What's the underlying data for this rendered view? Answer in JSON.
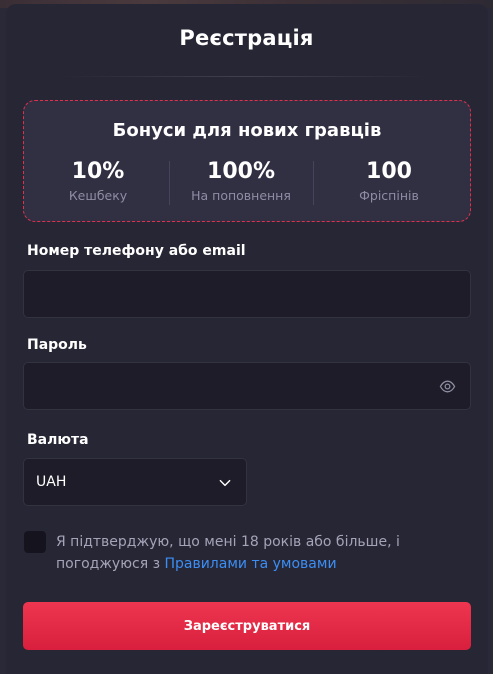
{
  "title": "Реєстрація",
  "bonuses": {
    "title": "Бонуси для нових гравців",
    "items": [
      {
        "value": "10%",
        "label": "Кешбеку"
      },
      {
        "value": "100%",
        "label": "На поповнення"
      },
      {
        "value": "100",
        "label": "Фріспінів"
      }
    ]
  },
  "form": {
    "login_label": "Номер телефону або email",
    "login_value": "",
    "password_label": "Пароль",
    "password_value": "",
    "currency_label": "Валюта",
    "currency_value": "UAH",
    "consent_text": "Я підтверджую, що мені 18 років або більше, і погоджуюся з ",
    "consent_link": "Правилами та умовами",
    "submit_label": "Зареєструватися"
  },
  "colors": {
    "accent": "#e0304e",
    "link": "#3b8ef5",
    "background": "#272634",
    "input_bg": "#1d1c28"
  },
  "icons": [
    "eye-icon",
    "chevron-down-icon"
  ]
}
